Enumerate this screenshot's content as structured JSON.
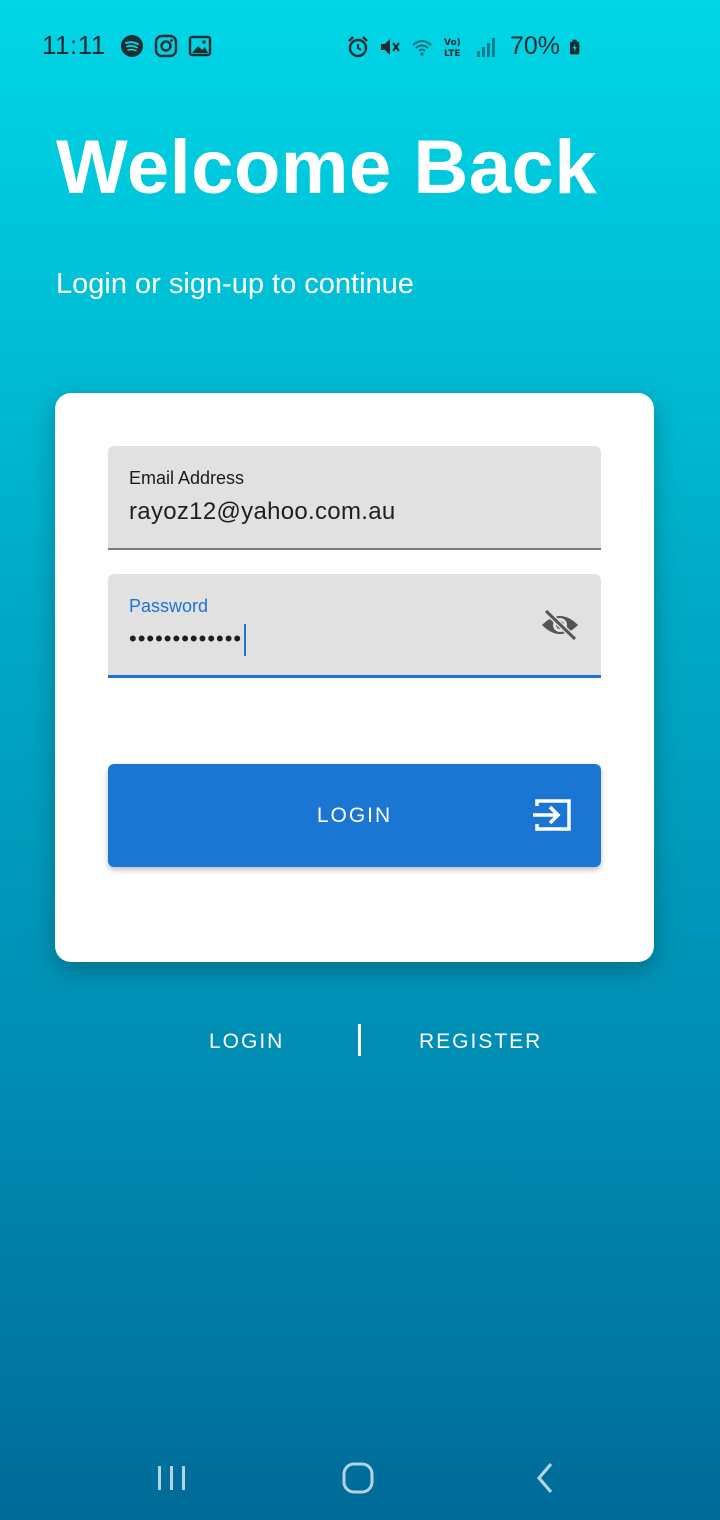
{
  "status_bar": {
    "time": "11:11",
    "battery": "70%"
  },
  "header": {
    "title": "Welcome Back",
    "subtitle": "Login or sign-up to continue"
  },
  "form": {
    "email": {
      "label": "Email Address",
      "value": "rayoz12@yahoo.com.au"
    },
    "password": {
      "label": "Password",
      "masked_value": "•••••••••••••"
    },
    "login_button_label": "LOGIN"
  },
  "bottom_links": {
    "login": "LOGIN",
    "register": "REGISTER"
  },
  "colors": {
    "accent": "#1b75d3",
    "background_top": "#00d6e6",
    "background_bottom": "#006a98"
  },
  "icons": {
    "status_left": [
      "spotify-icon",
      "instagram-icon",
      "gallery-icon"
    ],
    "status_right": [
      "alarm-icon",
      "mute-icon",
      "wifi-4g-icon",
      "volte-icon",
      "signal-icon",
      "battery-charging-icon"
    ],
    "password_toggle": "visibility-off-icon",
    "login_button": "login-arrow-icon",
    "navigation": [
      "recents-icon",
      "home-icon",
      "back-icon"
    ]
  }
}
